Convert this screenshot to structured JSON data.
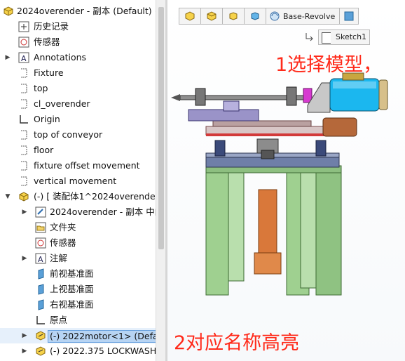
{
  "tree": {
    "root": "2024overender - 副本 (Default) <显",
    "items": [
      {
        "label": "历史记录",
        "icon": "history-icon"
      },
      {
        "label": "传感器",
        "icon": "sensor-icon"
      },
      {
        "label": "Annotations",
        "icon": "annotations-icon"
      },
      {
        "label": "Fixture",
        "icon": "sketch-plane-icon"
      },
      {
        "label": "top",
        "icon": "sketch-plane-icon"
      },
      {
        "label": "cl_overender",
        "icon": "sketch-plane-icon"
      },
      {
        "label": "Origin",
        "icon": "origin-icon"
      },
      {
        "label": "top of conveyor",
        "icon": "sketch-plane-icon"
      },
      {
        "label": "floor",
        "icon": "sketch-plane-icon"
      },
      {
        "label": "fixture offset movement",
        "icon": "sketch-plane-icon"
      },
      {
        "label": "vertical movement",
        "icon": "sketch-plane-icon"
      },
      {
        "label": "(-) [ 装配体1^2024overender -",
        "icon": "assembly-icon"
      },
      {
        "label": "2024overender - 副本 中的",
        "icon": "part-icon"
      },
      {
        "label": "文件夹",
        "icon": "folder-icon"
      },
      {
        "label": "传感器",
        "icon": "sensor-icon"
      },
      {
        "label": "注解",
        "icon": "annotations-icon"
      },
      {
        "label": "前视基准面",
        "icon": "plane-icon"
      },
      {
        "label": "上视基准面",
        "icon": "plane-icon"
      },
      {
        "label": "右视基准面",
        "icon": "plane-icon"
      },
      {
        "label": "原点",
        "icon": "origin-icon"
      },
      {
        "label": "(-) 2022motor<1> (Default",
        "icon": "component-icon"
      },
      {
        "label": "(-) 2022.375 LOCKWASHER",
        "icon": "component-icon"
      }
    ]
  },
  "breadcrumb": {
    "feature": "Base-Revolve",
    "sketch": "Sketch1"
  },
  "annotations": {
    "step1": "1选择模型，",
    "step2": "2对应名称高亮"
  },
  "colors": {
    "annotation": "#ff2a1a",
    "selection": "#b7d4f3",
    "motor": "#1bb7ef",
    "frame": "#9fd090",
    "cylinder": "#d9783a",
    "platform": "#6f7fa8"
  }
}
